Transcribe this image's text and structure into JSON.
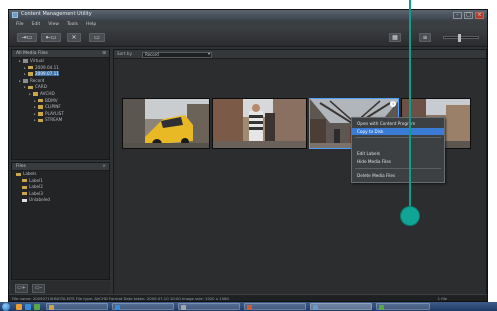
{
  "window": {
    "title": "Content Management Utility"
  },
  "menubar": [
    "File",
    "Edit",
    "View",
    "Tools",
    "Help"
  ],
  "folders": {
    "header": "All Media Files",
    "items": [
      {
        "label": "Virtual",
        "depth": 1,
        "type": "drive"
      },
      {
        "label": "2009.04.11",
        "depth": 2,
        "type": "folder"
      },
      {
        "label": "2009.07.11",
        "depth": 2,
        "type": "folder",
        "selected": true
      },
      {
        "label": "Record",
        "depth": 1,
        "type": "drive"
      },
      {
        "label": "CARD",
        "depth": 2,
        "type": "folder"
      },
      {
        "label": "AVCHD",
        "depth": 3,
        "type": "folder"
      },
      {
        "label": "BDMV",
        "depth": 4,
        "type": "folder"
      },
      {
        "label": "CLIPINF",
        "depth": 4,
        "type": "folder"
      },
      {
        "label": "PLAYLIST",
        "depth": 4,
        "type": "folder"
      },
      {
        "label": "STREAM",
        "depth": 4,
        "type": "folder"
      }
    ]
  },
  "labels": {
    "header": "Files",
    "items": [
      {
        "label": "Labels",
        "color": "#c9a64a"
      },
      {
        "label": "Label1",
        "color": "#c9a64a"
      },
      {
        "label": "Label2",
        "color": "#c9a64a"
      },
      {
        "label": "Label3",
        "color": "#c9a64a"
      },
      {
        "label": "Unlabeled",
        "color": "#e0e0e0"
      }
    ]
  },
  "main": {
    "sort_label": "Sort by",
    "sort_value": "Record"
  },
  "thumbnails": [
    {
      "badge": "",
      "flag": false
    },
    {
      "badge": "",
      "flag": false
    },
    {
      "badge": "i",
      "flag": true,
      "selected": true
    },
    {
      "badge": "",
      "flag": false
    }
  ],
  "context_menu": [
    "Open with Content Program",
    "Copy to Disk",
    "Edit Labels",
    "Hide Media Files",
    "Delete Media Files"
  ],
  "status": {
    "left": "File name: 20090710HNOTA.MTS   File type: AVCHD   Format   Date taken: 2009.07.10 10:00   Image size: 1920 x 1080",
    "right": "1 file"
  },
  "colors": {
    "accent": "#3a7bd5",
    "callout": "#10a595"
  }
}
